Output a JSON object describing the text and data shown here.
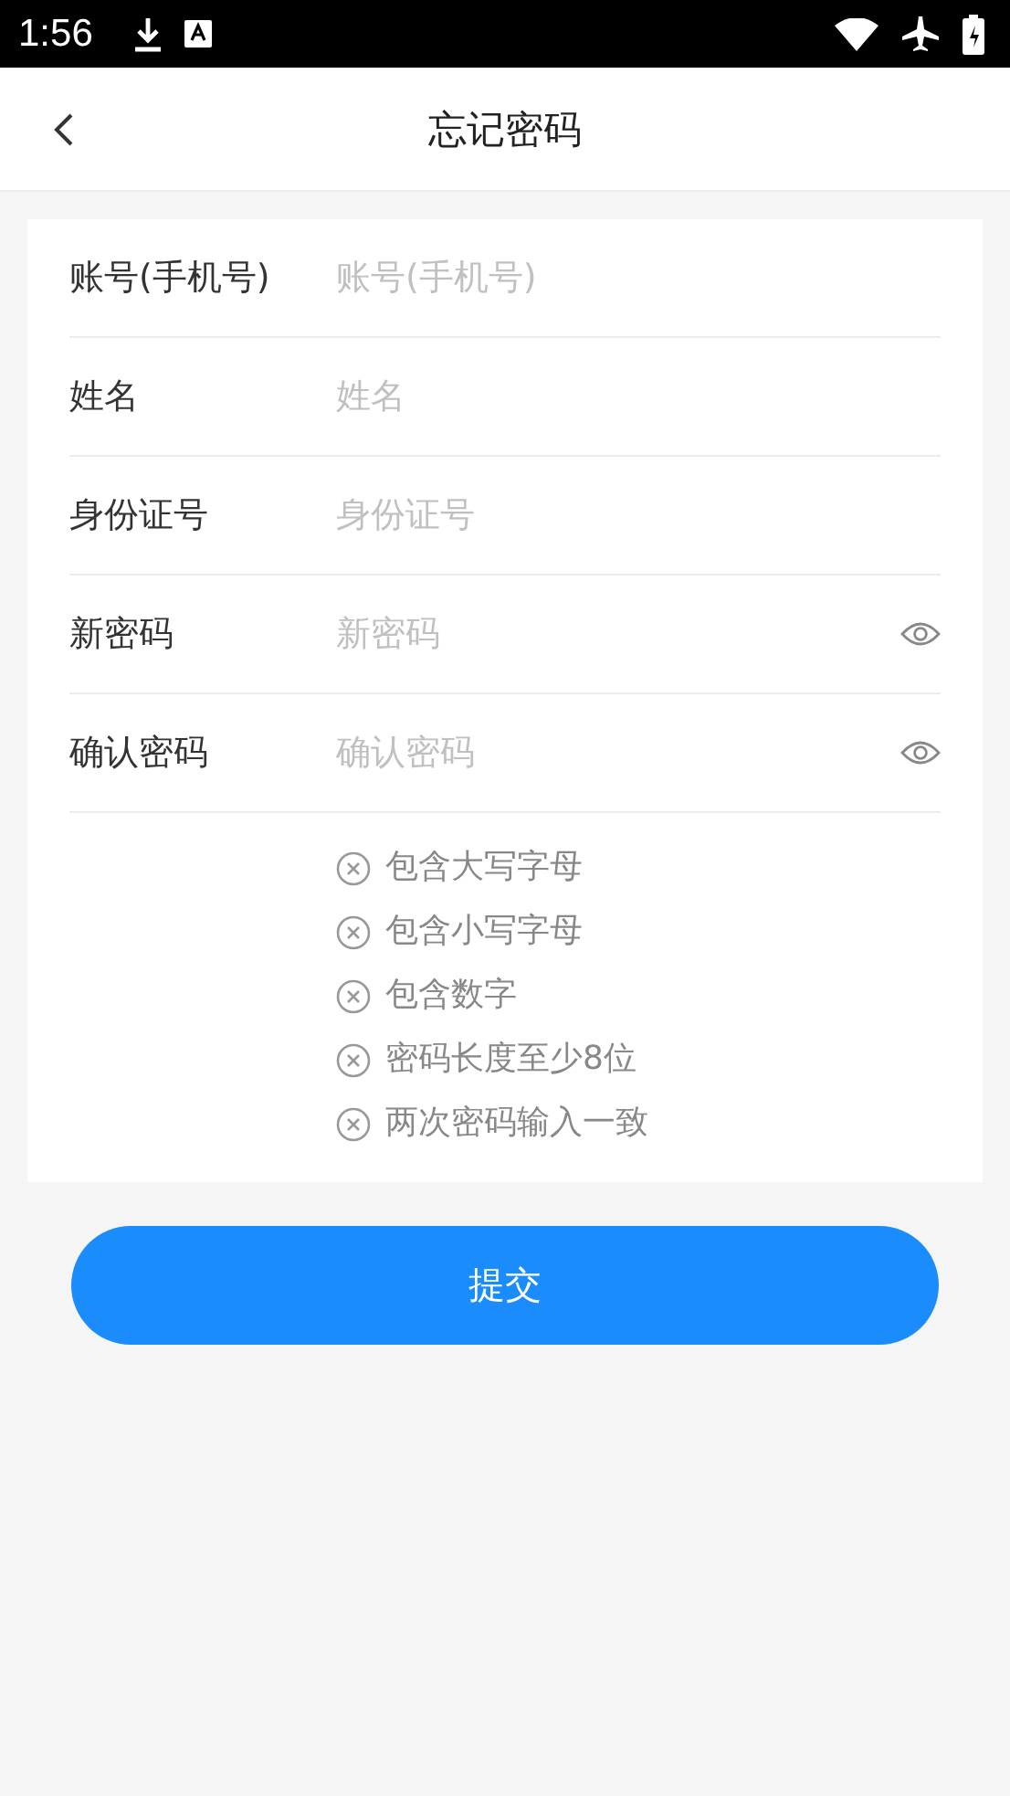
{
  "status_bar": {
    "time": "1:56"
  },
  "header": {
    "title": "忘记密码"
  },
  "fields": [
    {
      "label": "账号(手机号)",
      "placeholder": "账号(手机号)",
      "kind": "text"
    },
    {
      "label": "姓名",
      "placeholder": "姓名",
      "kind": "text"
    },
    {
      "label": "身份证号",
      "placeholder": "身份证号",
      "kind": "text"
    },
    {
      "label": "新密码",
      "placeholder": "新密码",
      "kind": "password"
    },
    {
      "label": "确认密码",
      "placeholder": "确认密码",
      "kind": "password"
    }
  ],
  "rules": [
    {
      "text": "包含大写字母",
      "met": false
    },
    {
      "text": "包含小写字母",
      "met": false
    },
    {
      "text": "包含数字",
      "met": false
    },
    {
      "text": "密码长度至少8位",
      "met": false
    },
    {
      "text": "两次密码输入一致",
      "met": false
    }
  ],
  "submit_button": "提交"
}
